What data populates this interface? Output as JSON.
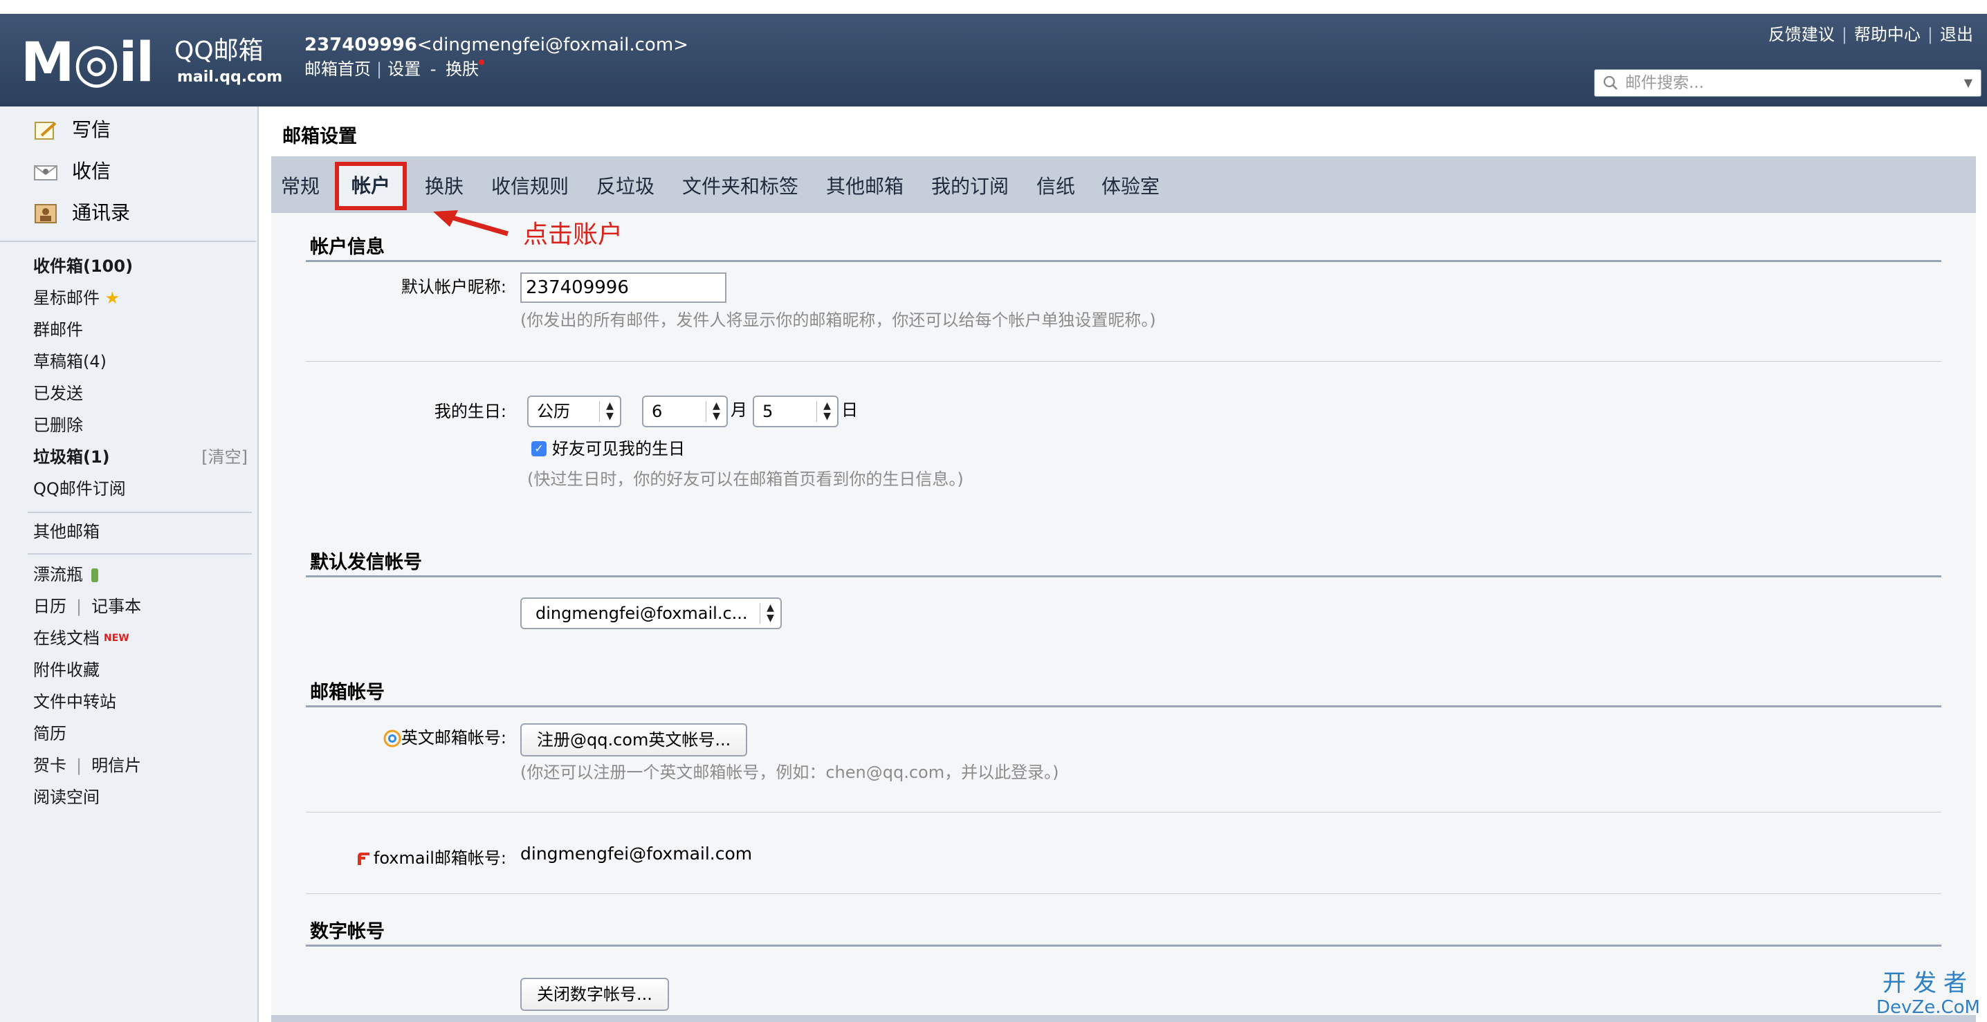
{
  "header": {
    "logo_mail": "M◎il",
    "logo_qq": "QQ邮箱",
    "logo_domain": "mail.qq.com",
    "account_id": "237409996",
    "account_email": "<dingmengfei@foxmail.com>",
    "nav_home": "邮箱首页",
    "nav_settings": "设置",
    "nav_dash": "-",
    "nav_skin": "换肤",
    "link_feedback": "反馈建议",
    "link_help": "帮助中心",
    "link_logout": "退出",
    "search_placeholder": "邮件搜索..."
  },
  "sidebar": {
    "compose": "写信",
    "receive": "收信",
    "contacts": "通讯录",
    "inbox": "收件箱(100)",
    "starred": "星标邮件",
    "group": "群邮件",
    "drafts": "草稿箱(4)",
    "sent": "已发送",
    "deleted": "已删除",
    "spam": "垃圾箱(1)",
    "spam_clear": "[清空]",
    "subscriptions": "QQ邮件订阅",
    "other_mailbox": "其他邮箱",
    "bottle": "漂流瓶",
    "calendar": "日历",
    "notes": "记事本",
    "docs": "在线文档",
    "docs_badge": "NEW",
    "attachments": "附件收藏",
    "transfer": "文件中转站",
    "resume": "简历",
    "cards": "贺卡",
    "postcards": "明信片",
    "reading": "阅读空间"
  },
  "main": {
    "title": "邮箱设置",
    "tabs": [
      "常规",
      "帐户",
      "换肤",
      "收信规则",
      "反垃圾",
      "文件夹和标签",
      "其他邮箱",
      "我的订阅",
      "信纸",
      "体验室"
    ],
    "annotation": "点击账户",
    "sec_account_info": "帐户信息",
    "nickname_label": "默认帐户昵称:",
    "nickname_value": "237409996",
    "nickname_hint": "(你发出的所有邮件，发件人将显示你的邮箱昵称，你还可以给每个帐户单独设置昵称。)",
    "birthday_label": "我的生日:",
    "calendar_type": "公历",
    "month_value": "6",
    "month_unit": "月",
    "day_value": "5",
    "day_unit": "日",
    "birthday_visible": "好友可见我的生日",
    "birthday_hint": "(快过生日时，你的好友可以在邮箱首页看到你的生日信息。)",
    "sec_default_sender": "默认发信帐号",
    "default_sender": "dingmengfei@foxmail.c...",
    "sec_mail_accounts": "邮箱帐号",
    "english_label": "英文邮箱帐号:",
    "english_button": "注册@qq.com英文帐号...",
    "english_hint": "(你还可以注册一个英文邮箱帐号，例如：chen@qq.com，并以此登录。)",
    "foxmail_label": "foxmail邮箱帐号:",
    "foxmail_value": "dingmengfei@foxmail.com",
    "sec_digital": "数字帐号",
    "digital_button": "关闭数字帐号..."
  },
  "watermark": {
    "line1": "开发者",
    "line2": "DevZe.CoM"
  },
  "colors": {
    "header_bg": "#34495f",
    "tab_bar": "#c6cfd9",
    "annotation_red": "#d9241c",
    "checkbox_blue": "#3b82f6"
  }
}
